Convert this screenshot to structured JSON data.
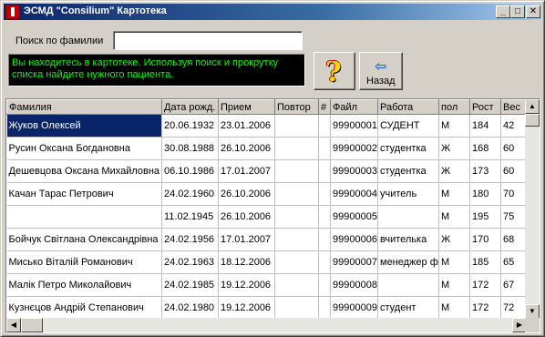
{
  "window": {
    "title": "ЭСМД \"Consilium\"  Картотека",
    "minimize": "_",
    "maximize": "□",
    "close": "✕"
  },
  "search": {
    "label": "Поиск по фамилии",
    "value": "",
    "placeholder": ""
  },
  "info_text": "Вы находитесь в картотеке. Используя поиск и прокрутку списка найдите нужного пациента.",
  "buttons": {
    "help_glyph": "?",
    "back_label": "Назад",
    "back_arrow": "⇦"
  },
  "table": {
    "columns": [
      "Фамилия",
      "Дата рожд.",
      "Прием",
      "Повтор",
      "#",
      "Файл",
      "Работа",
      "пол",
      "Рост",
      "Вес"
    ],
    "rows": [
      [
        "Жуков Олексей",
        "20.06.1932",
        "23.01.2006",
        "",
        "",
        "99900001",
        "СУДЕНТ",
        "М",
        "184",
        "42"
      ],
      [
        "Русин Оксана Богдановна",
        "30.08.1988",
        "26.10.2006",
        "",
        "",
        "99900002",
        "студентка",
        "Ж",
        "168",
        "60"
      ],
      [
        "Дешевцова Оксана Михайловна",
        "06.10.1986",
        "17.01.2007",
        "",
        "",
        "99900003",
        "студентка",
        "Ж",
        "173",
        "60"
      ],
      [
        "Качан  Тарас Петрович",
        "24.02.1960",
        "26.10.2006",
        "",
        "",
        "99900004",
        "учитель",
        "М",
        "180",
        "70"
      ],
      [
        "",
        "11.02.1945",
        "26.10.2006",
        "",
        "",
        "99900005",
        "",
        "М",
        "195",
        "75"
      ],
      [
        "Бойчук Світлана Олександрівна",
        "24.02.1956",
        "17.01.2007",
        "",
        "",
        "99900006",
        "вчителька",
        "Ж",
        "170",
        "68"
      ],
      [
        "Мисько Віталій Романович",
        "24.02.1963",
        "18.12.2006",
        "",
        "",
        "99900007",
        "менеджер фі",
        "М",
        "185",
        "65"
      ],
      [
        "Малік Петро Миколайович",
        "24.02.1985",
        "19.12.2006",
        "",
        "",
        "99900008",
        "",
        "М",
        "172",
        "67"
      ],
      [
        "Кузнєцов Андрій Степанович",
        "24.02.1980",
        "19.12.2006",
        "",
        "",
        "99900009",
        "студент",
        "М",
        "172",
        "72"
      ]
    ],
    "selected_row": 0
  },
  "scroll": {
    "up": "▲",
    "down": "▼",
    "left": "◀",
    "right": "▶"
  }
}
